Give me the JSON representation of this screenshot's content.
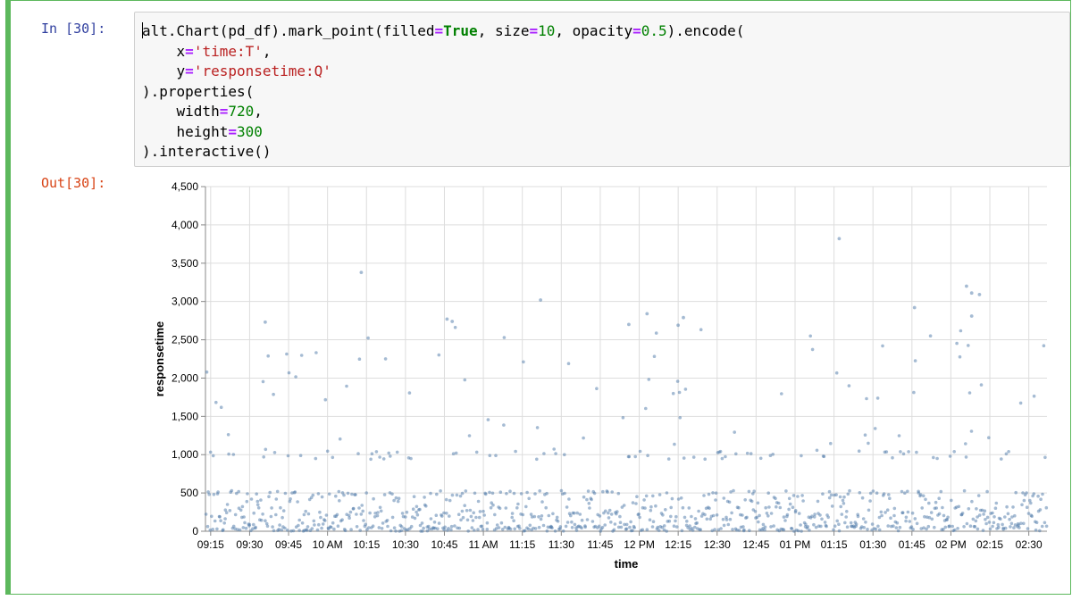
{
  "notebook": {
    "input_prompt": "In [30]:",
    "output_prompt": "Out[30]:",
    "code_lines": [
      [
        [
          "plain",
          "alt.Chart(pd_df).mark_point(filled"
        ],
        [
          "op",
          "="
        ],
        [
          "kw",
          "True"
        ],
        [
          "plain",
          ", size"
        ],
        [
          "op",
          "="
        ],
        [
          "num",
          "10"
        ],
        [
          "plain",
          ", opacity"
        ],
        [
          "op",
          "="
        ],
        [
          "num",
          "0.5"
        ],
        [
          "plain",
          ").encode("
        ]
      ],
      [
        [
          "plain",
          "    x"
        ],
        [
          "op",
          "="
        ],
        [
          "str",
          "'time:T'"
        ],
        [
          "plain",
          ","
        ]
      ],
      [
        [
          "plain",
          "    y"
        ],
        [
          "op",
          "="
        ],
        [
          "str",
          "'responsetime:Q'"
        ]
      ],
      [
        [
          "plain",
          ").properties("
        ]
      ],
      [
        [
          "plain",
          "    width"
        ],
        [
          "op",
          "="
        ],
        [
          "num",
          "720"
        ],
        [
          "plain",
          ","
        ]
      ],
      [
        [
          "plain",
          "    height"
        ],
        [
          "op",
          "="
        ],
        [
          "num",
          "300"
        ]
      ],
      [
        [
          "plain",
          ").interactive()"
        ]
      ]
    ]
  },
  "colors": {
    "cell_border": "#5cb85c",
    "point": "#4c78a8",
    "grid": "#dddddd",
    "axis": "#888888"
  },
  "chart_data": {
    "type": "scatter",
    "xlabel": "time",
    "ylabel": "responsetime",
    "ylim": [
      0,
      4500
    ],
    "y_ticks": [
      0,
      500,
      1000,
      1500,
      2000,
      2500,
      3000,
      3500,
      4000,
      4500
    ],
    "y_tick_labels": [
      "0",
      "500",
      "1,000",
      "1,500",
      "2,000",
      "2,500",
      "3,000",
      "3,500",
      "4,000",
      "4,500"
    ],
    "x_range": [
      "09:13",
      "14:37"
    ],
    "x_ticks": [
      "09:15",
      "09:30",
      "09:45",
      "10:00",
      "10:15",
      "10:30",
      "10:45",
      "11:00",
      "11:15",
      "11:30",
      "11:45",
      "12:00",
      "12:15",
      "12:30",
      "12:45",
      "13:00",
      "13:15",
      "13:30",
      "13:45",
      "14:00",
      "14:15",
      "14:30"
    ],
    "x_tick_labels": [
      "09:15",
      "09:30",
      "09:45",
      "10 AM",
      "10:15",
      "10:30",
      "10:45",
      "11 AM",
      "11:15",
      "11:30",
      "11:45",
      "12 PM",
      "12:15",
      "12:30",
      "12:45",
      "01 PM",
      "01:15",
      "01:30",
      "01:45",
      "02 PM",
      "02:15",
      "02:30"
    ],
    "grid": true,
    "point_opacity": 0.5,
    "outliers": [
      {
        "x": "13:17",
        "y": 3820
      },
      {
        "x": "10:13",
        "y": 3380
      },
      {
        "x": "14:06",
        "y": 3200
      },
      {
        "x": "14:08",
        "y": 3110
      },
      {
        "x": "14:11",
        "y": 3090
      },
      {
        "x": "11:22",
        "y": 3020
      },
      {
        "x": "12:03",
        "y": 2840
      },
      {
        "x": "12:17",
        "y": 2790
      },
      {
        "x": "10:46",
        "y": 2770
      },
      {
        "x": "14:08",
        "y": 2810
      },
      {
        "x": "13:46",
        "y": 2920
      },
      {
        "x": "12:15",
        "y": 2690
      },
      {
        "x": "09:36",
        "y": 2730
      },
      {
        "x": "10:48",
        "y": 2740
      },
      {
        "x": "11:56",
        "y": 2700
      }
    ],
    "bands": [
      {
        "y": 0,
        "label": "dense band near 0"
      },
      {
        "y": 200,
        "label": "dense band near 200"
      },
      {
        "y": 500,
        "label": "band near 500"
      },
      {
        "y": 1000,
        "label": "band near 1,000"
      }
    ]
  }
}
